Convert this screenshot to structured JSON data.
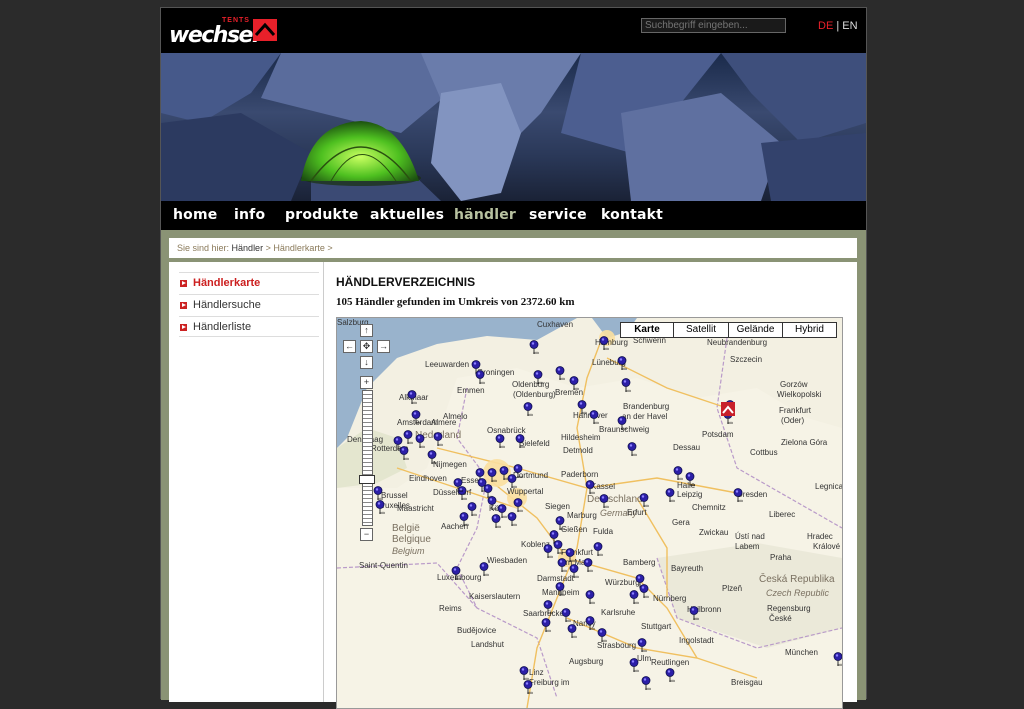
{
  "header": {
    "logo_word": "wechsel",
    "logo_tents": "TENTS",
    "search_placeholder": "Suchbegriff eingeben...",
    "lang_de": "DE",
    "lang_sep": "|",
    "lang_en": "EN"
  },
  "nav": {
    "items": [
      "home",
      "info",
      "produkte",
      "aktuelles",
      "händler",
      "service",
      "kontakt"
    ],
    "active": "händler"
  },
  "breadcrumb": {
    "prefix": "Sie sind hier:",
    "level1": "Händler",
    "sep1": ">",
    "level2": "Händlerkarte",
    "sep2": ">"
  },
  "sidebar": {
    "items": [
      "Händlerkarte",
      "Händlersuche",
      "Händlerliste"
    ]
  },
  "main": {
    "title": "HÄNDLERVERZEICHNIS",
    "result": "105 Händler gefunden im Umkreis von 2372.60  km"
  },
  "map": {
    "types": [
      "Karte",
      "Satellit",
      "Gelände",
      "Hybrid"
    ],
    "selected_type": "Karte",
    "countries": [
      "Nederland",
      "België",
      "Belgique",
      "Belgium",
      "Deutschland",
      "Germany",
      "Česká Republika",
      "Czech Republic"
    ],
    "cities": [
      "Cuxhaven",
      "Hamburg",
      "Schwerin",
      "Neubrandenburg",
      "Szczecin",
      "Leeuwarden",
      "Groningen",
      "Emmen",
      "Oldenburg",
      "(Oldenburg)",
      "Bremen",
      "Lüneburg",
      "Gorzów",
      "Wielkopolski",
      "Alkmaar",
      "Almelo",
      "Amsterdam",
      "Almere",
      "Osnabrück",
      "Hannover",
      "Brandenburg",
      "an der Havel",
      "Potsdam",
      "Frankfurt",
      "(Oder)",
      "Den Haag",
      "Rotterdam",
      "Bielefeld",
      "Hildesheim",
      "Braunschweig",
      "Detmold",
      "Dessau",
      "Zielona Góra",
      "Cottbus",
      "Nijmegen",
      "Eindhoven",
      "Essen",
      "Dortmund",
      "Paderborn",
      "Kassel",
      "Halle",
      "Leipzig",
      "Dresden",
      "Brussel",
      "Bruxelles",
      "Düsseldorf",
      "Wuppertal",
      "Köln",
      "Siegen",
      "Gera",
      "Chemnitz",
      "Zwickau",
      "Liberec",
      "Legnica",
      "Maastricht",
      "Aachen",
      "Erfurt",
      "Marburg",
      "Gießen",
      "Fulda",
      "Ústí nad",
      "Labem",
      "Hradec",
      "Králové",
      "Koblenz",
      "Wiesbaden",
      "Frankfurt",
      "am Main",
      "Praha",
      "Saint-Quentin",
      "Luxembourg",
      "Darmstadt",
      "Bamberg",
      "Bayreuth",
      "Würzburg",
      "Plzeň",
      "Kaiserslautern",
      "Mannheim",
      "Nürnberg",
      "Reims",
      "Saarbrücken",
      "Karlsruhe",
      "Heilbronn",
      "Regensburg",
      "České",
      "Budějovice",
      "Nancy",
      "Stuttgart",
      "Ingolstadt",
      "Landshut",
      "Strasbourg",
      "Ulm",
      "Augsburg",
      "Reutlingen",
      "München",
      "Linz",
      "Freiburg im",
      "Breisgau",
      "Salzburg"
    ]
  }
}
